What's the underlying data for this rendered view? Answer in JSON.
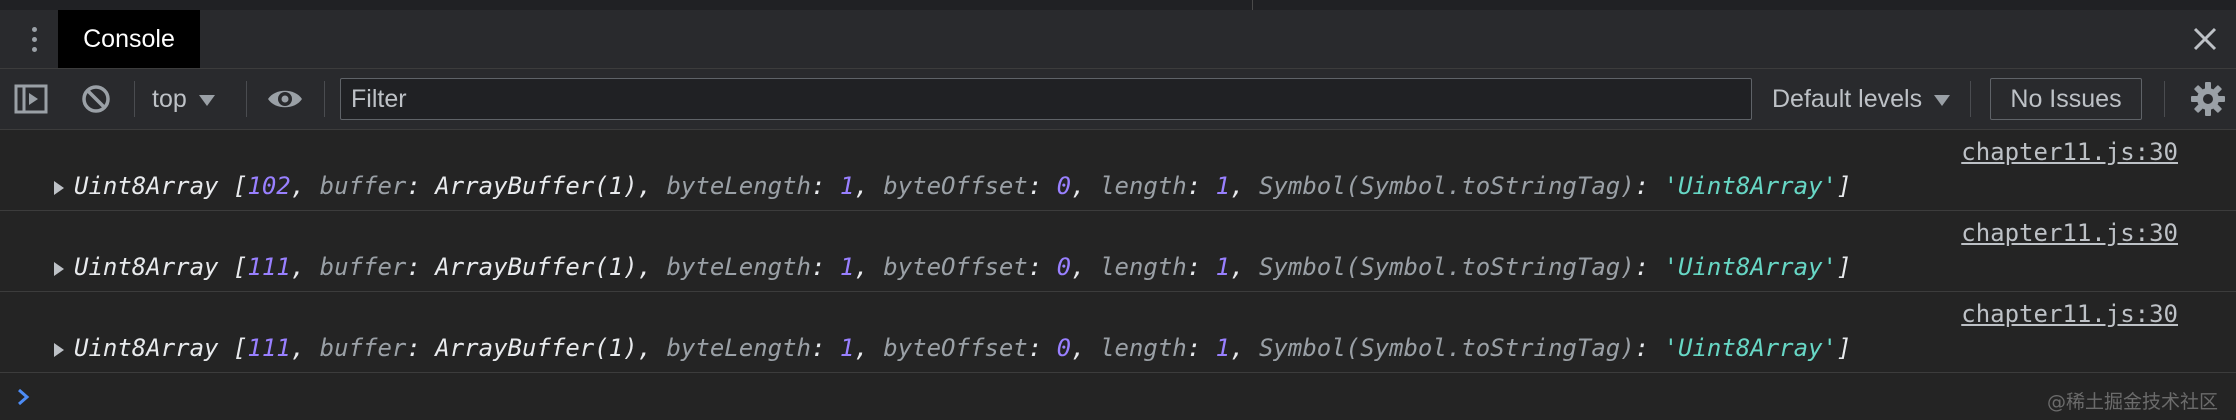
{
  "tabs": {
    "console_label": "Console"
  },
  "toolbar": {
    "context": "top",
    "filter_placeholder": "Filter",
    "levels": "Default levels",
    "issues": "No Issues"
  },
  "messages": [
    {
      "source": "chapter11.js:30",
      "type_name": "Uint8Array",
      "value": "102",
      "buffer": "ArrayBuffer(1)",
      "byteLength": "1",
      "byteOffset": "0",
      "length": "1",
      "tag_key": "Symbol(Symbol.toStringTag)",
      "tag_value": "'Uint8Array'"
    },
    {
      "source": "chapter11.js:30",
      "type_name": "Uint8Array",
      "value": "111",
      "buffer": "ArrayBuffer(1)",
      "byteLength": "1",
      "byteOffset": "0",
      "length": "1",
      "tag_key": "Symbol(Symbol.toStringTag)",
      "tag_value": "'Uint8Array'"
    },
    {
      "source": "chapter11.js:30",
      "type_name": "Uint8Array",
      "value": "111",
      "buffer": "ArrayBuffer(1)",
      "byteLength": "1",
      "byteOffset": "0",
      "length": "1",
      "tag_key": "Symbol(Symbol.toStringTag)",
      "tag_value": "'Uint8Array'"
    }
  ],
  "watermark": "@稀土掘金技术社区",
  "colors": {
    "background": "#242424",
    "toolbar": "#292a2d",
    "number": "#9980ff",
    "string": "#67d7c5",
    "key": "#9aa0a6"
  },
  "icons": {
    "menu": "kebab-menu-icon",
    "close": "close-icon",
    "sidebar": "sidebar-toggle-icon",
    "clear": "clear-console-icon",
    "eye": "live-expression-eye-icon",
    "settings": "gear-icon",
    "prompt": "chevron-right-icon"
  }
}
